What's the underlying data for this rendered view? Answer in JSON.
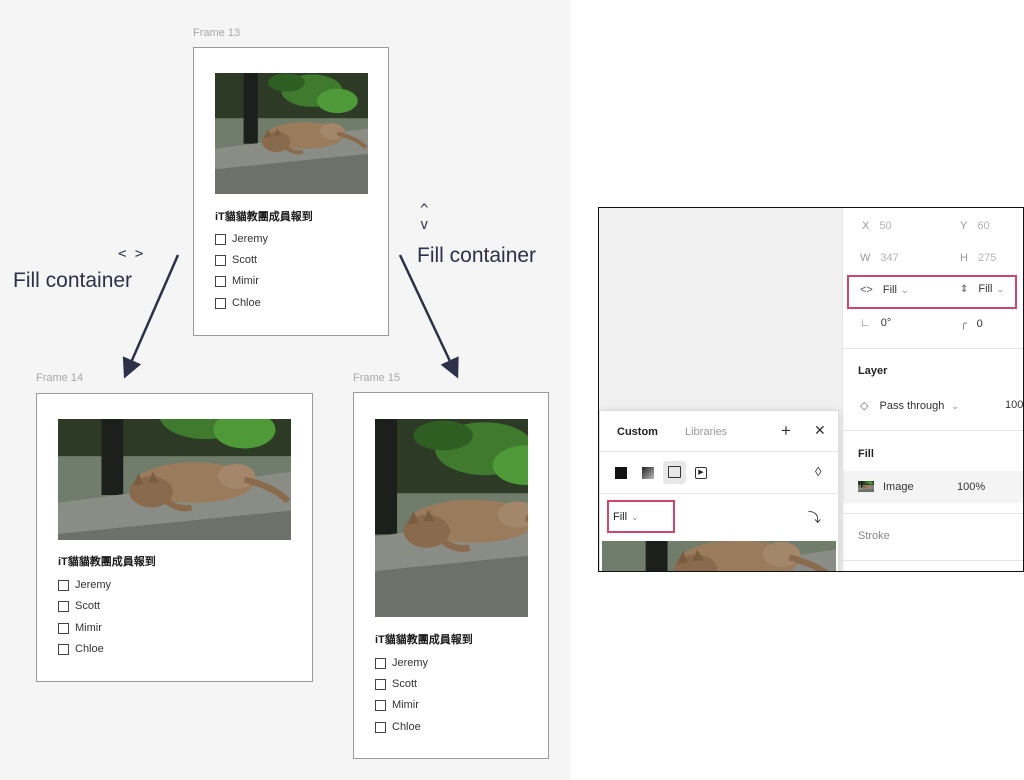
{
  "card": {
    "title": "iT貓貓教團成員報到",
    "items": [
      "Jeremy",
      "Scott",
      "Mimir",
      "Chloe"
    ]
  },
  "frames": {
    "top": "Frame 13",
    "left": "Frame 14",
    "right": "Frame 15"
  },
  "annotations": {
    "horizontal_icon": "< >",
    "horizontal_label": "Fill container",
    "vertical_icon_up": "^",
    "vertical_icon_down": "v",
    "vertical_label": "Fill container"
  },
  "panel": {
    "x_label": "X",
    "x_value": "50",
    "y_label": "Y",
    "y_value": "60",
    "w_label": "W",
    "w_value": "347",
    "h_label": "H",
    "h_value": "275",
    "h_resize_icon": "<>",
    "h_resize_value": "Fill",
    "v_resize_value": "Fill",
    "rotation": "0°",
    "radius": "0",
    "layer_title": "Layer",
    "blend_mode": "Pass through",
    "opacity_partial": "100",
    "fill_title": "Fill",
    "fill_type": "Image",
    "fill_opacity": "100%",
    "stroke_title": "Stroke"
  },
  "popup": {
    "tab_custom": "Custom",
    "tab_libraries": "Libraries",
    "add_icon": "+",
    "close_icon": "✕",
    "scale_mode": "Fill"
  },
  "colors": {
    "highlight": "#d0456b",
    "annotation": "#2d3148",
    "canvas": "#f5f5f5"
  }
}
